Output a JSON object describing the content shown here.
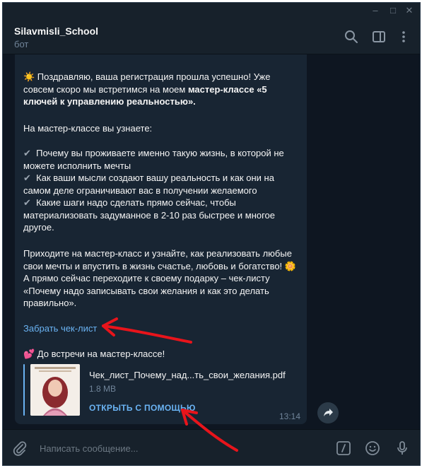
{
  "window": {
    "controls": [
      "–",
      "□",
      "✕"
    ]
  },
  "header": {
    "title": "Silavmisli_School",
    "status": "бот",
    "icons": [
      "search-icon",
      "sidebar-toggle-icon",
      "more-vertical-icon"
    ]
  },
  "message": {
    "greeting_emoji": "☀️",
    "intro_plain": " Поздравляю, ваша регистрация прошла успешно! Уже совсем скоро мы встретимся на моем ",
    "intro_bold": "мастер-классе «5 ключей к управлению реальностью».",
    "learn_heading": "На мастер-классе вы узнаете:",
    "bullets": [
      "Почему вы проживаете именно такую жизнь, в которой не можете исполнить мечты",
      "Как ваши мысли создают вашу реальность и как они на самом деле ограничивают вас в получении желаемого",
      "Какие шаги надо сделать прямо сейчас, чтобы материализовать задуманное в 2-10 раз быстрее и многое другое."
    ],
    "bullet_mark": "✔",
    "cta_text": "Приходите на мастер-класс и узнайте, как реализовать любые свои мечты и впустить в жизнь счастье, любовь и богатство! 🌼 А прямо сейчас переходите к своему подарку – чек-листу «Почему надо записывать свои желания и как это делать правильно».",
    "link_label": "Забрать чек-лист",
    "farewell": "💕 До встречи на мастер-классе!",
    "time": "13:14"
  },
  "document": {
    "filename": "Чек_лист_Почему_над...ть_свои_желания.pdf",
    "size": "1.8 MB",
    "open_label": "ОТКРЫТЬ С ПОМОЩЬЮ"
  },
  "composer": {
    "placeholder": "Написать сообщение..."
  },
  "colors": {
    "background": "#0e1621",
    "panel": "#17212b",
    "bubble": "#182533",
    "accent": "#6ab3f3",
    "annotation_arrow": "#e8141b"
  }
}
